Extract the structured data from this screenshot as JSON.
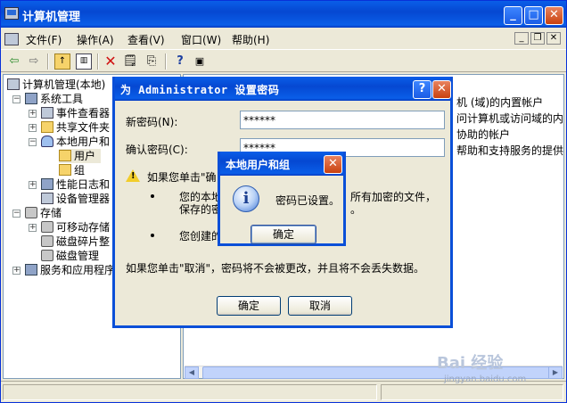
{
  "main": {
    "title": "计算机管理",
    "menu": [
      "文件(F)",
      "操作(A)",
      "查看(V)",
      "窗口(W)",
      "帮助(H)"
    ]
  },
  "tree": {
    "root": "计算机管理(本地)",
    "system_tools": "系统工具",
    "event_viewer": "事件查看器",
    "shared_folders": "共享文件夹",
    "local_users": "本地用户和",
    "users": "用户",
    "groups": "组",
    "perf_logs": "性能日志和",
    "device_manager": "设备管理器",
    "storage": "存储",
    "removable": "可移动存储",
    "defrag": "磁盘碎片整",
    "disk_mgmt": "磁盘管理",
    "services": "服务和应用程序"
  },
  "right_pane": {
    "lines": [
      "机 (域)的内置帐户",
      "问计算机或访问域的内",
      "协助的帐户",
      "帮助和支持服务的提供"
    ]
  },
  "pwd_dialog": {
    "title": "为 Administrator 设置密码",
    "new_password_label": "新密码(N):",
    "new_password_value": "******",
    "confirm_label": "确认密码(C):",
    "confirm_value": "******",
    "warn_text": "如果您单击\"确",
    "bullet1_a": "您的本地",
    "bullet1_b": "保存的密",
    "bullet1_right_a": "所有加密的文件，",
    "bullet1_right_b": "。",
    "bullet2": "您创建的",
    "cancel_note": "如果您单击\"取消\"，密码将不会被更改，并且将不会丢失数据。",
    "ok_label": "确定",
    "cancel_label": "取消"
  },
  "msgbox": {
    "title": "本地用户和组",
    "message": "密码已设置。",
    "ok_label": "确定"
  },
  "watermark": {
    "brand": "Bai 经验",
    "url": "jingyan.baidu.com"
  }
}
